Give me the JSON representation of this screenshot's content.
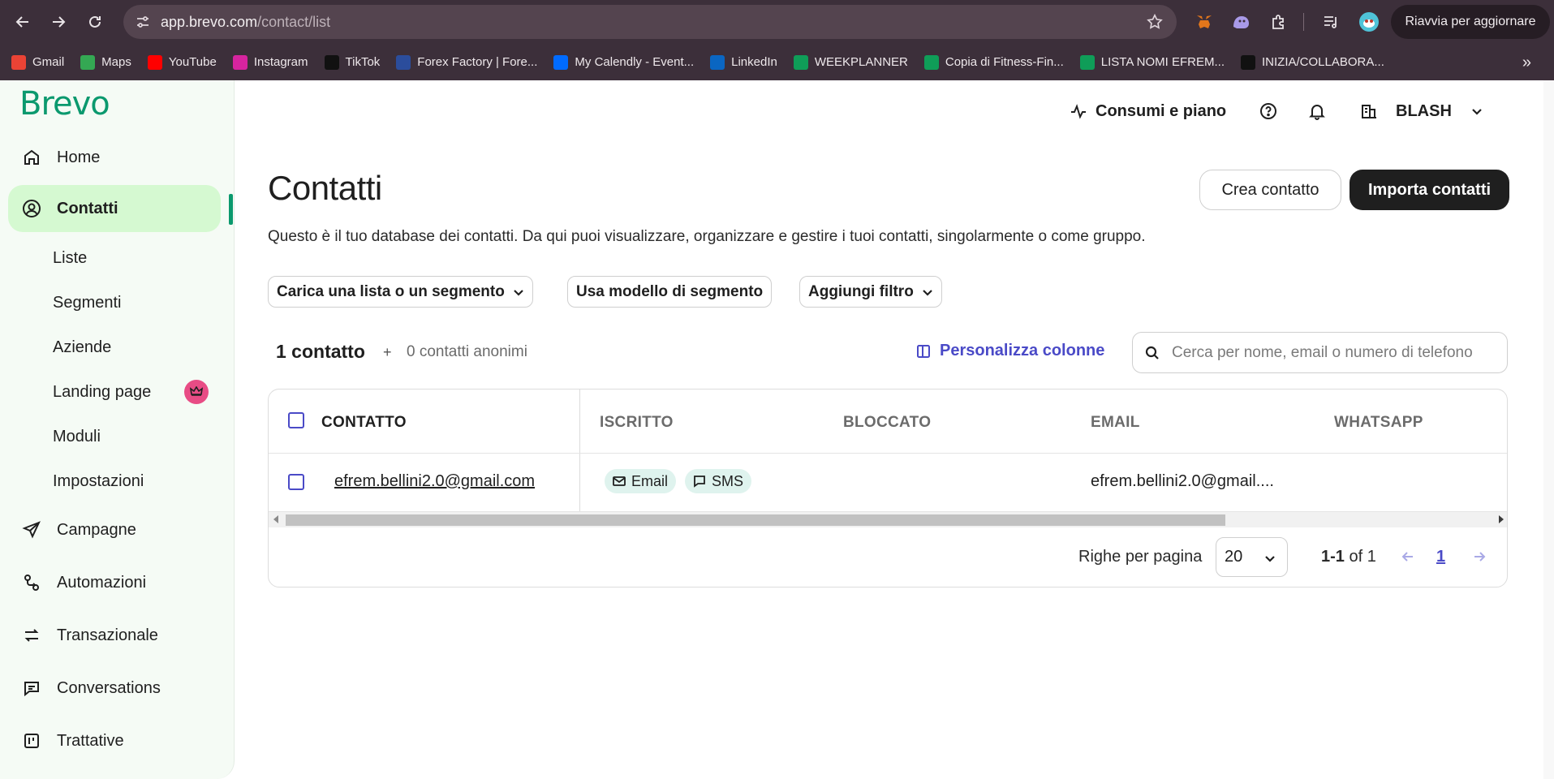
{
  "browser": {
    "url_host": "app.brevo.com",
    "url_path": "/contact/list",
    "update_label": "Riavvia per aggiornare"
  },
  "bookmarks": [
    {
      "label": "Gmail",
      "icon": "gmail-icon",
      "color": "#ea4335"
    },
    {
      "label": "Maps",
      "icon": "maps-icon",
      "color": "#34a853"
    },
    {
      "label": "YouTube",
      "icon": "youtube-icon",
      "color": "#ff0000"
    },
    {
      "label": "Instagram",
      "icon": "instagram-icon",
      "color": "#d6249f"
    },
    {
      "label": "TikTok",
      "icon": "tiktok-icon",
      "color": "#111111"
    },
    {
      "label": "Forex Factory | Fore...",
      "icon": "forexfactory-icon",
      "color": "#2b4d9c"
    },
    {
      "label": "My Calendly - Event...",
      "icon": "calendly-icon",
      "color": "#006bff"
    },
    {
      "label": "LinkedIn",
      "icon": "linkedin-icon",
      "color": "#0a66c2"
    },
    {
      "label": "WEEKPLANNER",
      "icon": "sheets-icon",
      "color": "#0f9d58"
    },
    {
      "label": "Copia di Fitness-Fin...",
      "icon": "sheets-icon",
      "color": "#0f9d58"
    },
    {
      "label": "LISTA NOMI EFREM...",
      "icon": "sheets-icon",
      "color": "#0f9d58"
    },
    {
      "label": "INIZIA/COLLABORA...",
      "icon": "asterisk-icon",
      "color": "#111111"
    }
  ],
  "sidebar": {
    "logo": "Brevo",
    "items": [
      {
        "label": "Home"
      },
      {
        "label": "Contatti"
      },
      {
        "label": "Campagne"
      },
      {
        "label": "Automazioni"
      },
      {
        "label": "Transazionale"
      },
      {
        "label": "Conversations"
      },
      {
        "label": "Trattative"
      }
    ],
    "sub_items": [
      {
        "label": "Liste"
      },
      {
        "label": "Segmenti"
      },
      {
        "label": "Aziende"
      },
      {
        "label": "Landing page"
      },
      {
        "label": "Moduli"
      },
      {
        "label": "Impostazioni"
      }
    ]
  },
  "topbar": {
    "usage": "Consumi e piano",
    "account": "BLASH"
  },
  "main": {
    "title": "Contatti",
    "create_button": "Crea contatto",
    "import_button": "Importa contatti",
    "description": "Questo è il tuo database dei contatti. Da qui puoi visualizzare, organizzare e gestire i tuoi contatti, singolarmente o come gruppo.",
    "filters": {
      "load_list": "Carica una lista o un segmento",
      "segment_model": "Usa modello di segmento",
      "add_filter": "Aggiungi filtro"
    },
    "count": "1 contatto",
    "plus": "+",
    "anonymous": "0 contatti anonimi",
    "customize_columns": "Personalizza colonne",
    "search_placeholder": "Cerca per nome, email o numero di telefono"
  },
  "table": {
    "columns": [
      "CONTATTO",
      "ISCRITTO",
      "BLOCCATO",
      "EMAIL",
      "WHATSAPP"
    ],
    "rows": [
      {
        "contact": "efrem.bellini2.0@gmail.com",
        "subscribed": [
          "Email",
          "SMS"
        ],
        "blocked": "",
        "email": "efrem.bellini2.0@gmail....",
        "whatsapp": ""
      }
    ]
  },
  "pagination": {
    "rows_per_page_label": "Righe per pagina",
    "rows_per_page": "20",
    "range_bold": "1-1",
    "range_rest": " of 1",
    "current_page": "1"
  },
  "colors": {
    "brand_green": "#0b996e",
    "active_bg": "#d5f9d1",
    "accent_purple": "#4a4ac7",
    "tag_bg": "#dff3ee",
    "crown_pink": "#e84c85"
  }
}
